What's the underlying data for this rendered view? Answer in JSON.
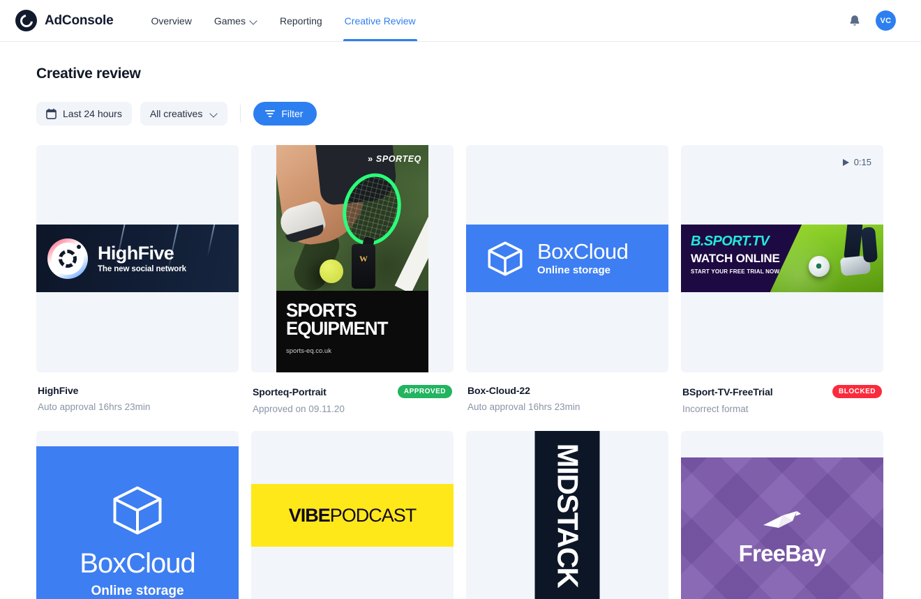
{
  "header": {
    "brand": "AdConsole",
    "logo_icon": "adconsole-logo-icon",
    "nav": [
      {
        "label": "Overview",
        "active": false,
        "has_chevron": false
      },
      {
        "label": "Games",
        "active": false,
        "has_chevron": true
      },
      {
        "label": "Reporting",
        "active": false,
        "has_chevron": false
      },
      {
        "label": "Creative Review",
        "active": true,
        "has_chevron": false
      }
    ],
    "notification_icon": "bell-icon",
    "avatar_initials": "VC",
    "accent_color": "#2d7ff0"
  },
  "page": {
    "title": "Creative review"
  },
  "controls": {
    "date_range": "Last 24 hours",
    "date_icon": "calendar-icon",
    "creative_filter": "All creatives",
    "filter_button": "Filter",
    "filter_icon": "filter-icon"
  },
  "creatives": [
    {
      "name": "HighFive",
      "status_text": "Auto approval 16hrs 23min",
      "badge": "",
      "badge_type": "none",
      "art": "highfive",
      "art_title": "HighFive",
      "art_subtitle": "The new social network"
    },
    {
      "name": "Sporteq-Portrait",
      "status_text": "Approved on 09.11.20",
      "badge": "APPROVED",
      "badge_type": "approved",
      "art": "sporteq",
      "art_brand": "SPORTEQ",
      "art_line1": "SPORTS",
      "art_line2": "EQUIPMENT",
      "art_url": "sports-eq.co.uk"
    },
    {
      "name": "Box-Cloud-22",
      "status_text": "Auto approval 16hrs 23min",
      "badge": "",
      "badge_type": "none",
      "art": "boxcloud-banner",
      "art_title": "BoxCloud",
      "art_subtitle": "Online storage"
    },
    {
      "name": "BSport-TV-FreeTrial",
      "status_text": "Incorrect format",
      "badge": "BLOCKED",
      "badge_type": "blocked",
      "art": "bsport",
      "video_duration": "0:15",
      "art_title": "B.SPORT.TV",
      "art_line2": "WATCH ONLINE",
      "art_line3": "START YOUR FREE TRIAL NOW"
    },
    {
      "name": "",
      "status_text": "",
      "badge": "",
      "badge_type": "none",
      "art": "boxcloud-square",
      "art_title": "BoxCloud",
      "art_subtitle": "Online storage"
    },
    {
      "name": "",
      "status_text": "",
      "badge": "",
      "badge_type": "none",
      "art": "vibepodcast",
      "art_bold": "VIBE",
      "art_light": "PODCAST"
    },
    {
      "name": "",
      "status_text": "",
      "badge": "",
      "badge_type": "none",
      "art": "dstack",
      "art_title": "MIDSTACK"
    },
    {
      "name": "",
      "status_text": "",
      "badge": "",
      "badge_type": "none",
      "art": "freebay",
      "art_title": "FreeBay"
    }
  ],
  "colors": {
    "accent": "#2d7ff0",
    "approved": "#22b45f",
    "blocked": "#fa2b3c",
    "thumb_bg": "#f2f5fa",
    "dark": "#121a2e"
  }
}
